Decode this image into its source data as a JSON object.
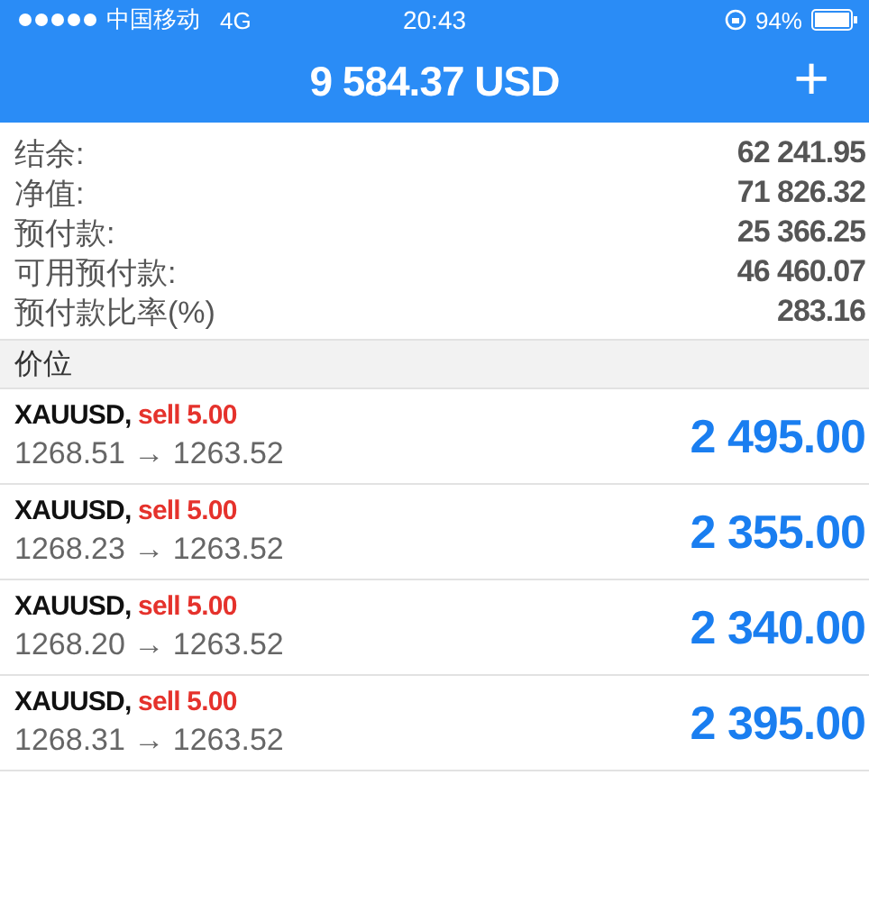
{
  "status_bar": {
    "carrier": "中国移动",
    "network": "4G",
    "time": "20:43",
    "battery": "94%"
  },
  "header": {
    "title": "9 584.37 USD",
    "action": "+"
  },
  "summary": [
    {
      "label": "结余:",
      "value": "62 241.95"
    },
    {
      "label": "净值:",
      "value": "71 826.32"
    },
    {
      "label": "预付款:",
      "value": "25 366.25"
    },
    {
      "label": "可用预付款:",
      "value": "46 460.07"
    },
    {
      "label": "预付款比率(%)",
      "value": "283.16"
    }
  ],
  "section": {
    "title": "价位"
  },
  "positions": [
    {
      "symbol": "XAUUSD,",
      "order": "sell 5.00",
      "prices": "1268.51 → 1263.52",
      "profit": "2 495.00"
    },
    {
      "symbol": "XAUUSD,",
      "order": "sell 5.00",
      "prices": "1268.23 → 1263.52",
      "profit": "2 355.00"
    },
    {
      "symbol": "XAUUSD,",
      "order": "sell 5.00",
      "prices": "1268.20 → 1263.52",
      "profit": "2 340.00"
    },
    {
      "symbol": "XAUUSD,",
      "order": "sell 5.00",
      "prices": "1268.31 → 1263.52",
      "profit": "2 395.00"
    }
  ]
}
